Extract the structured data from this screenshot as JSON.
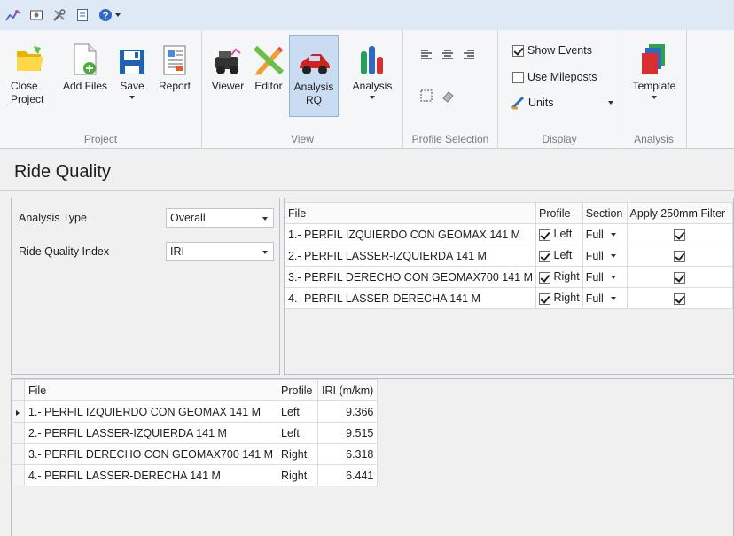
{
  "ribbon": {
    "groups": {
      "project": "Project",
      "view": "View",
      "profile_selection": "Profile Selection",
      "display": "Display",
      "analysis": "Analysis"
    },
    "buttons": {
      "close_project": "Close Project",
      "add_files": "Add Files",
      "save": "Save",
      "report": "Report",
      "viewer": "Viewer",
      "editor": "Editor",
      "analysis_rq": "Analysis RQ",
      "analysis": "Analysis",
      "template": "Template"
    },
    "display_options": {
      "show_events": "Show Events",
      "use_mileposts": "Use Mileposts",
      "units": "Units"
    }
  },
  "page": {
    "title": "Ride Quality"
  },
  "settings": {
    "analysis_type_label": "Analysis Type",
    "analysis_type_value": "Overall",
    "index_label": "Ride Quality Index",
    "index_value": "IRI"
  },
  "files_grid": {
    "headers": {
      "file": "File",
      "profile": "Profile",
      "section": "Section",
      "filter": "Apply 250mm Filter"
    },
    "rows": [
      {
        "file": "1.- PERFIL IZQUIERDO CON GEOMAX 141 M",
        "profile": "Left",
        "section": "Full"
      },
      {
        "file": "2.- PERFIL LASSER-IZQUIERDA 141 M",
        "profile": "Left",
        "section": "Full"
      },
      {
        "file": "3.- PERFIL DERECHO CON GEOMAX700 141 M",
        "profile": "Right",
        "section": "Full"
      },
      {
        "file": "4.- PERFIL LASSER-DERECHA 141 M",
        "profile": "Right",
        "section": "Full"
      }
    ]
  },
  "results_grid": {
    "headers": {
      "file": "File",
      "profile": "Profile",
      "iri": "IRI (m/km)"
    },
    "rows": [
      {
        "file": "1.- PERFIL IZQUIERDO CON GEOMAX 141 M",
        "profile": "Left",
        "iri": "9.366"
      },
      {
        "file": "2.- PERFIL LASSER-IZQUIERDA 141 M",
        "profile": "Left",
        "iri": "9.515"
      },
      {
        "file": "3.- PERFIL DERECHO CON GEOMAX700 141 M",
        "profile": "Right",
        "iri": "6.318"
      },
      {
        "file": "4.- PERFIL LASSER-DERECHA 141 M",
        "profile": "Right",
        "iri": "6.441"
      }
    ]
  }
}
